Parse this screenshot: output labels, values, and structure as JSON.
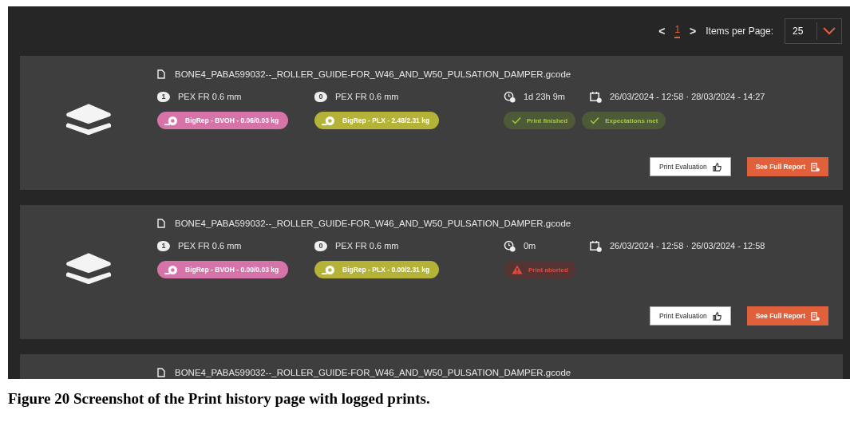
{
  "pagination": {
    "prev": "<",
    "pages": [
      {
        "label": "1",
        "selected": true
      }
    ],
    "next": ">",
    "items_per_page_label": "Items per Page:",
    "items_per_page": "25"
  },
  "prints": [
    {
      "filename": "BONE4_PABA599032--_ROLLER_GUIDE-FOR_W46_AND_W50_PULSATION_DAMPER.gcode",
      "extruders": [
        {
          "number": "1",
          "nozzle": "PEX FR 0.6 mm"
        },
        {
          "number": "0",
          "nozzle": "PEX FR 0.6 mm"
        }
      ],
      "duration": "1d 23h 9m",
      "dates": "26/03/2024 - 12:58 · 28/03/2024 - 14:27",
      "materials": [
        {
          "label": "BigRep - BVOH - 0.06/0.03 kg",
          "color": "#d673a8"
        },
        {
          "label": "BigRep - PLX - 2.48/2.31 kg",
          "color": "#b4b237"
        }
      ],
      "statuses": [
        {
          "kind": "success",
          "label": "Print finished"
        },
        {
          "kind": "success",
          "label": "Expectations met"
        }
      ],
      "evaluation_button": "Print Evaluation",
      "report_button": "See Full Report"
    },
    {
      "filename": "BONE4_PABA599032--_ROLLER_GUIDE-FOR_W46_AND_W50_PULSATION_DAMPER.gcode",
      "extruders": [
        {
          "number": "1",
          "nozzle": "PEX FR 0.6 mm"
        },
        {
          "number": "0",
          "nozzle": "PEX FR 0.6 mm"
        }
      ],
      "duration": "0m",
      "dates": "26/03/2024 - 12:58 · 26/03/2024 - 12:58",
      "materials": [
        {
          "label": "BigRep - BVOH - 0.00/0.03 kg",
          "color": "#d673a8"
        },
        {
          "label": "BigRep - PLX - 0.00/2.31 kg",
          "color": "#b4b237"
        }
      ],
      "statuses": [
        {
          "kind": "error",
          "label": "Print aborted"
        }
      ],
      "evaluation_button": "Print Evaluation",
      "report_button": "See Full Report"
    },
    {
      "filename": "BONE4_PABA599032--_ROLLER_GUIDE-FOR_W46_AND_W50_PULSATION_DAMPER.gcode"
    }
  ],
  "caption": "Figure 20 Screenshot of the Print history page with logged prints."
}
